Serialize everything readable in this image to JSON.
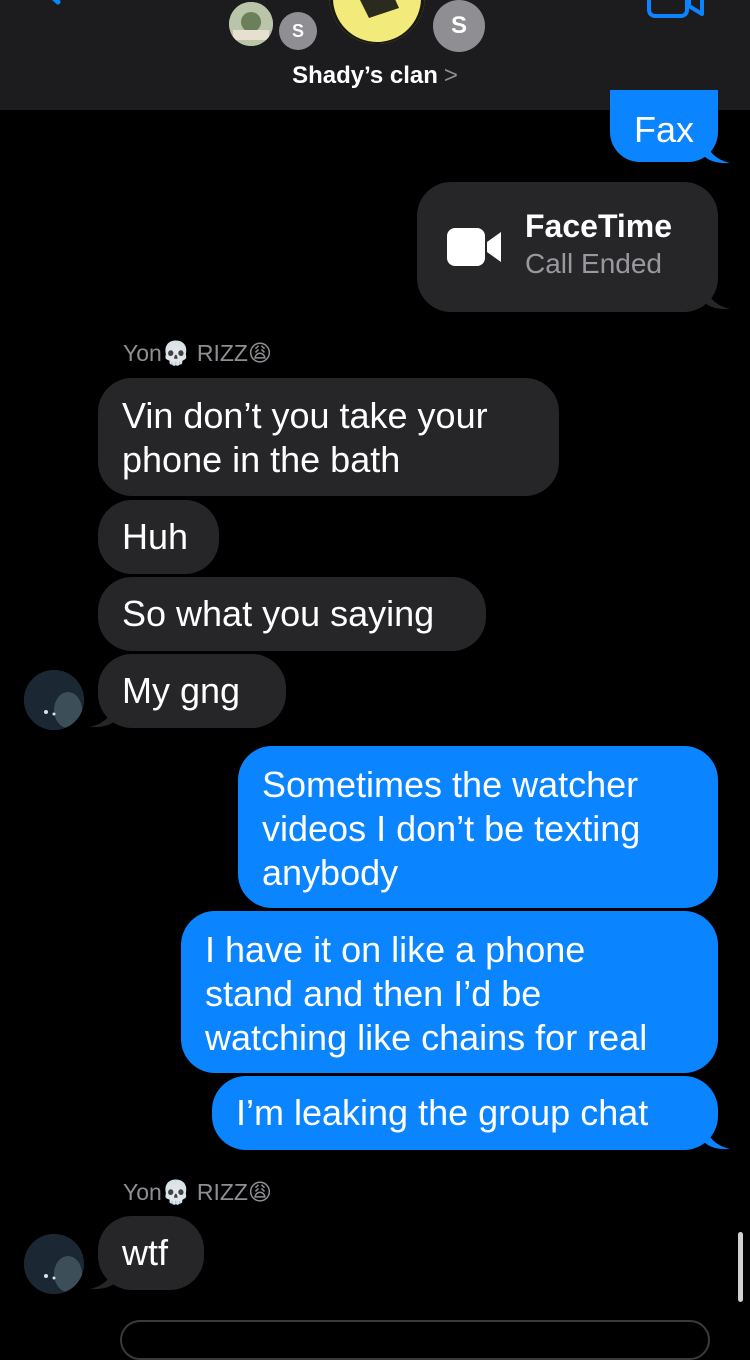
{
  "header": {
    "group_name": "Shady’s clan",
    "chevron": ">",
    "avatar_initial_1": "S",
    "avatar_initial_2": "S",
    "accent": "#0a84ff"
  },
  "messages": {
    "fax": "Fax",
    "facetime_title": "FaceTime",
    "facetime_status": "Call Ended",
    "sender_1": {
      "name_a": "Yon",
      "emoji_a": "💀",
      "name_b": "RIZZ",
      "emoji_b": "😩"
    },
    "m1_line1": "Vin don’t you take your",
    "m1_line2": "phone in the bath",
    "m2": "Huh",
    "m3": "So what you saying",
    "m4": "My gng",
    "o1_line1": "Sometimes the watcher",
    "o1_line2": "videos I don’t be texting",
    "o1_line3": "anybody",
    "o2_line1": "I have it on like a phone",
    "o2_line2": "stand and then I’d be",
    "o2_line3": "watching like chains for real",
    "o3": "I’m leaking the group chat",
    "sender_2": {
      "name_a": "Yon",
      "emoji_a": "💀",
      "name_b": "RIZZ",
      "emoji_b": "😩"
    },
    "m5": "wtf"
  },
  "icons": [
    "back-chevron-icon",
    "video-call-icon",
    "facetime-camera-icon"
  ],
  "colors": {
    "incoming": "#262628",
    "outgoing": "#0a84ff",
    "header": "#1c1c1e"
  }
}
